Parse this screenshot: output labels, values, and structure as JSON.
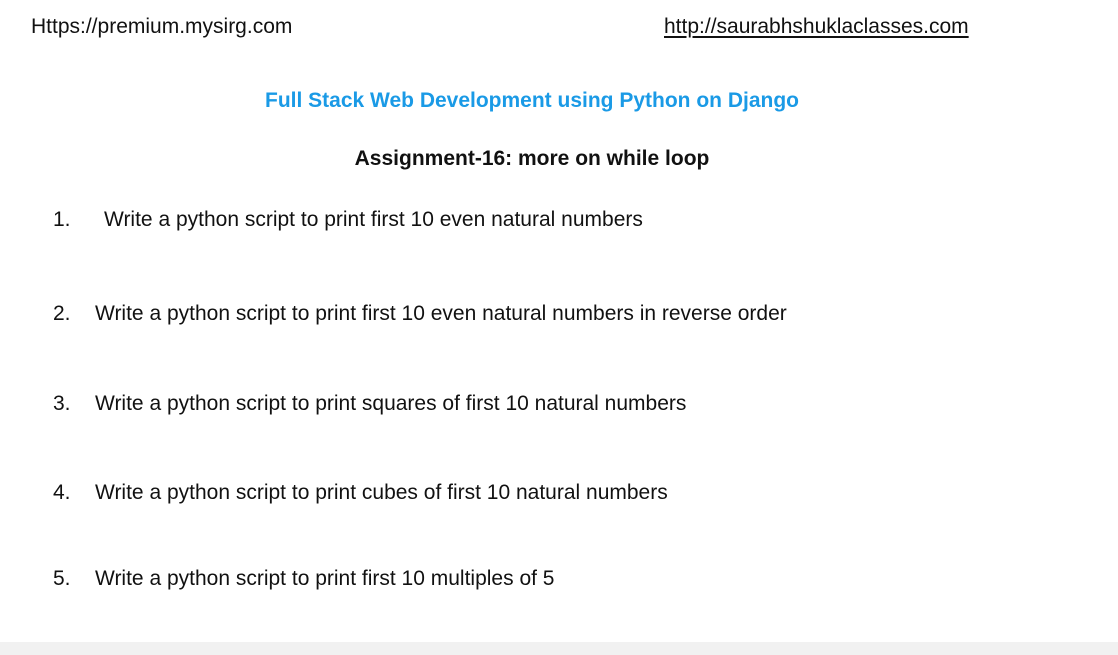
{
  "header": {
    "left_url": "Https://premium.mysirg.com",
    "right_url": "http://saurabhshuklaclasses.com"
  },
  "document": {
    "course_title": "Full Stack Web Development using Python on Django",
    "assignment_title": "Assignment-16: more on while loop",
    "tasks": [
      {
        "number": "1.",
        "text": "Write a python script to print first 10 even natural numbers"
      },
      {
        "number": "2.",
        "text": "Write a python script to print first 10 even natural numbers in reverse order"
      },
      {
        "number": "3.",
        "text": "Write a python script to print squares of first 10 natural numbers"
      },
      {
        "number": "4.",
        "text": "Write a python script to print cubes of first 10 natural numbers"
      },
      {
        "number": "5.",
        "text": "Write a python script to print first 10 multiples of 5"
      }
    ]
  },
  "colors": {
    "course_title": "#1a9ae6",
    "text": "#111111",
    "bottom_strip": "#f1f1f1"
  }
}
